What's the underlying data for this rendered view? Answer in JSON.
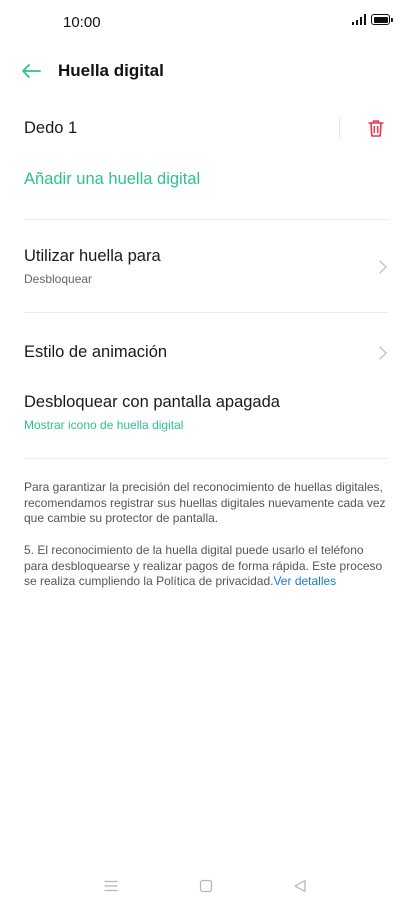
{
  "status_bar": {
    "time": "10:00"
  },
  "header": {
    "title": "Huella digital",
    "back_icon": "arrow-left-icon"
  },
  "fingerprint": {
    "name": "Dedo 1",
    "delete_icon": "trash-icon"
  },
  "add_fingerprint": {
    "label": "Añadir una huella digital"
  },
  "use_fingerprint": {
    "title": "Utilizar huella para",
    "value": "Desbloquear"
  },
  "animation_style": {
    "title": "Estilo de animación"
  },
  "screen_off_unlock": {
    "title": "Desbloquear con pantalla apagada",
    "subtitle": "Mostrar icono de huella digital"
  },
  "info": {
    "paragraph1": "Para garantizar la precisión del reconocimiento de huellas digitales, recomendamos registrar sus huellas digitales nuevamente cada vez que cambie su protector de pantalla.",
    "paragraph2": "5. El reconocimiento de la huella digital puede usarlo el teléfono para desbloquearse y realizar pagos de forma rápida. Este proceso se realiza cumpliendo la Política de privacidad.",
    "details_link": "Ver detalles"
  },
  "colors": {
    "accent": "#2fc28e",
    "delete": "#e5374a",
    "link": "#1a7bd0"
  },
  "nav_bar": {
    "icons": [
      "menu-icon",
      "home-icon",
      "back-triangle-icon"
    ]
  }
}
